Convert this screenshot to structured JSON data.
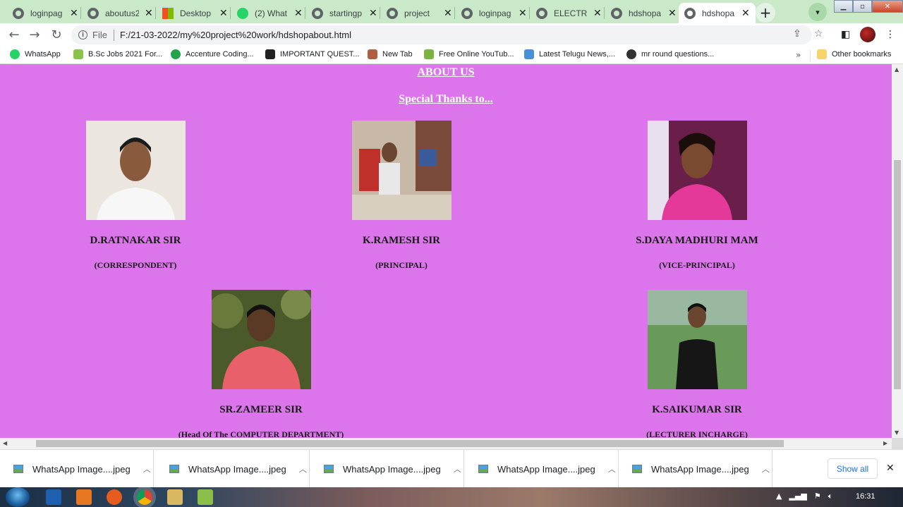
{
  "tabs": [
    {
      "label": "loginpag",
      "icon": "globe-icon"
    },
    {
      "label": "aboutus2",
      "icon": "globe-icon"
    },
    {
      "label": "Desktop",
      "icon": "windows-icon"
    },
    {
      "label": "(2) What",
      "icon": "whatsapp-icon"
    },
    {
      "label": "startingp",
      "icon": "globe-icon"
    },
    {
      "label": "project",
      "icon": "globe-icon"
    },
    {
      "label": "loginpag",
      "icon": "globe-icon"
    },
    {
      "label": "ELECTRO",
      "icon": "globe-icon"
    },
    {
      "label": "hdshopa",
      "icon": "globe-icon"
    },
    {
      "label": "hdshopa",
      "icon": "globe-icon",
      "active": true
    }
  ],
  "toolbar": {
    "scheme": "File",
    "url": "F:/21-03-2022/my%20project%20work/hdshopabout.html"
  },
  "bookmarks": [
    {
      "label": "WhatsApp",
      "color": "#25d366"
    },
    {
      "label": "B.Sc Jobs 2021 For...",
      "color": "#8bc34a"
    },
    {
      "label": "Accenture Coding...",
      "color": "#22a34a"
    },
    {
      "label": "IMPORTANT QUEST...",
      "color": "#222222"
    },
    {
      "label": "New Tab",
      "color": "#b06040"
    },
    {
      "label": "Free Online YouTub...",
      "color": "#7cb342"
    },
    {
      "label": "Latest Telugu News,...",
      "color": "#4a90d9"
    },
    {
      "label": "mr round questions...",
      "color": "#333333"
    }
  ],
  "bookmarks_other": "Other bookmarks",
  "page": {
    "heading": "ABOUT US",
    "subheading": "Special Thanks to...",
    "background": "#dc74ec",
    "people": [
      {
        "name": "D.RATNAKAR SIR",
        "role": "(CORRESPONDENT)"
      },
      {
        "name": "K.RAMESH SIR",
        "role": "(PRINCIPAL)"
      },
      {
        "name": "S.DAYA MADHURI MAM",
        "role": "(VICE-PRINCIPAL)"
      },
      {
        "name": "SR.ZAMEER SIR",
        "role": "(Head Of The COMPUTER DEPARTMENT)"
      },
      {
        "name": "K.SAIKUMAR SIR",
        "role": "(LECTURER INCHARGE)"
      }
    ]
  },
  "downloads": {
    "items": [
      "WhatsApp Image....jpeg",
      "WhatsApp Image....jpeg",
      "WhatsApp Image....jpeg",
      "WhatsApp Image....jpeg",
      "WhatsApp Image....jpeg"
    ],
    "show_all": "Show all"
  },
  "taskbar": {
    "clock": "16:31"
  }
}
